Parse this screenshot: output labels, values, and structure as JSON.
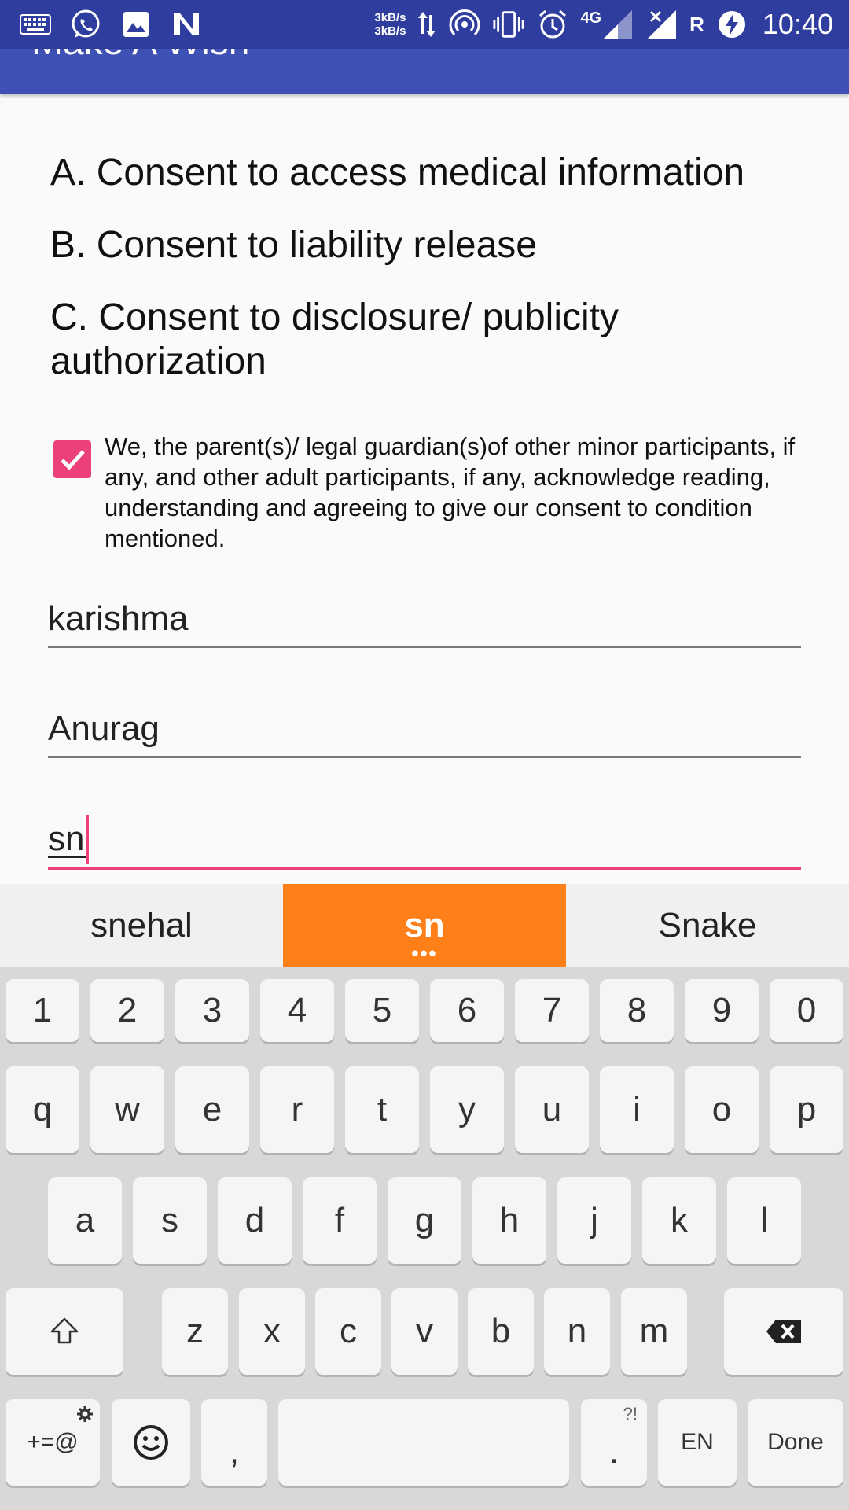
{
  "status_bar": {
    "speed_up": "3kB/s",
    "speed_down": "3kB/s",
    "network": "4G",
    "roaming": "R",
    "time": "10:40"
  },
  "app_bar": {
    "title": "Make A Wish"
  },
  "consents": [
    "A. Consent to access medical information",
    "B. Consent to liability release",
    "C. Consent to disclosure/ publicity authorization"
  ],
  "acknowledgement": {
    "checked": true,
    "text": "We, the parent(s)/ legal guardian(s)of other minor participants, if any, and other adult participants, if any, acknowledge reading, understanding and agreeing to give our consent to condition mentioned."
  },
  "fields": {
    "field1_value": "karishma",
    "field2_value": "Anurag",
    "field3_value": "sn"
  },
  "suggestions": [
    "snehal",
    "sn",
    "Snake"
  ],
  "keyboard": {
    "row_numbers": [
      "1",
      "2",
      "3",
      "4",
      "5",
      "6",
      "7",
      "8",
      "9",
      "0"
    ],
    "row1": [
      "q",
      "w",
      "e",
      "r",
      "t",
      "y",
      "u",
      "i",
      "o",
      "p"
    ],
    "row2": [
      "a",
      "s",
      "d",
      "f",
      "g",
      "h",
      "j",
      "k",
      "l"
    ],
    "row3": [
      "z",
      "x",
      "c",
      "v",
      "b",
      "n",
      "m"
    ],
    "symbols_label": "+=@",
    "comma_label": ",",
    "period_label": ".",
    "period_sup": "?!",
    "language_label": "EN",
    "done_label": "Done"
  },
  "colors": {
    "status_bar": "#2f3e9e",
    "app_bar": "#3f51b5",
    "accent": "#ec407a",
    "suggestion_highlight": "#ff8019"
  }
}
